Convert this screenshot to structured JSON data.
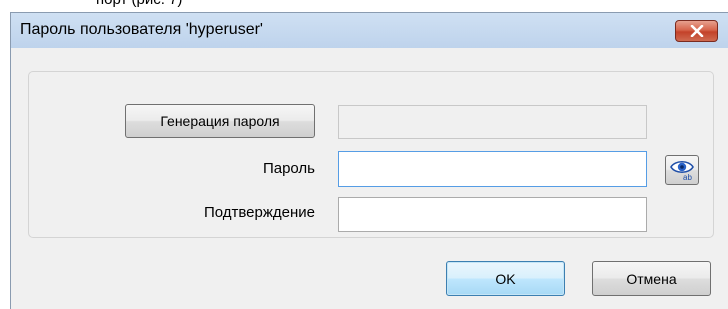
{
  "background_title_fragment": "порт (рис. 7)",
  "dialog": {
    "title": "Пароль пользователя 'hyperuser'",
    "close_icon": "close-icon",
    "colors": {
      "close_button": "#c3422a",
      "titlebar": "#cfe0f3",
      "focus_border": "#569de5"
    }
  },
  "form": {
    "generate_button_label": "Генерация пароля",
    "generated_password_value": "",
    "password_label": "Пароль",
    "password_value": "",
    "confirm_label": "Подтверждение",
    "confirm_value": "",
    "show_password_icon": "eye-icon",
    "show_password_subtext": "ab"
  },
  "buttons": {
    "ok_label": "OK",
    "cancel_label": "Отмена"
  }
}
